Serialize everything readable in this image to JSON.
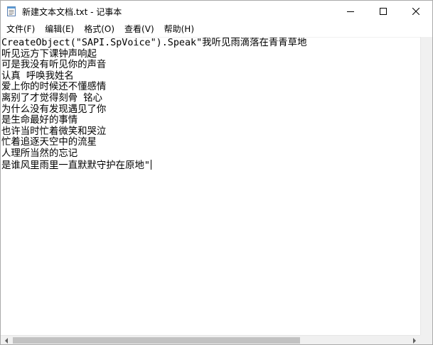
{
  "window": {
    "title": "新建文本文档.txt - 记事本"
  },
  "menu": [
    {
      "label": "文件(F)"
    },
    {
      "label": "编辑(E)"
    },
    {
      "label": "格式(O)"
    },
    {
      "label": "查看(V)"
    },
    {
      "label": "帮助(H)"
    }
  ],
  "editor": {
    "lines": [
      "CreateObject(\"SAPI.SpVoice\").Speak\"我听见雨滴落在青青草地",
      "听见远方下课钟声响起",
      "可是我没有听见你的声音",
      "认真 呼唤我姓名",
      "爱上你的时候还不懂感情",
      "离别了才觉得刻骨 铭心",
      "为什么没有发现遇见了你",
      "是生命最好的事情",
      "也许当时忙着微笑和哭泣",
      "忙着追逐天空中的流星",
      "人理所当然的忘记",
      "是谁风里雨里一直默默守护在原地\""
    ]
  },
  "icons": {
    "app": "notepad-icon",
    "minimize": "minimize-icon",
    "maximize": "maximize-icon",
    "close": "close-icon"
  }
}
